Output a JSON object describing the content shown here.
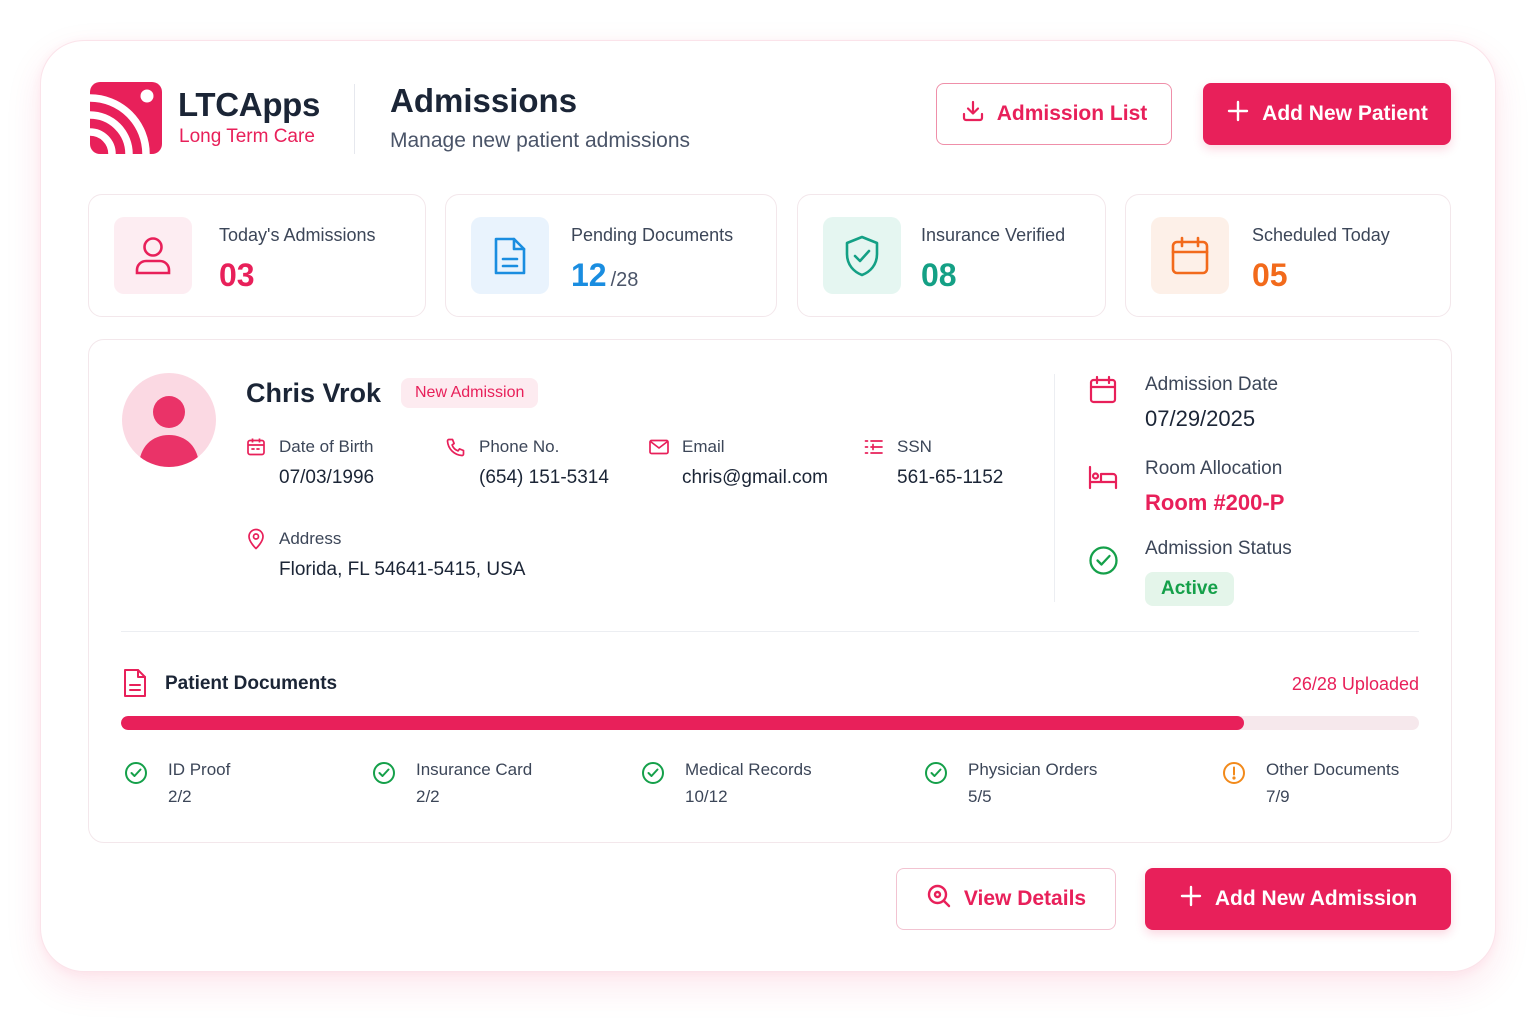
{
  "brand": {
    "name": "LTCApps",
    "subtitle": "Long Term Care"
  },
  "header": {
    "title": "Admissions",
    "subtitle": "Manage new patient admissions",
    "admission_list_label": "Admission List",
    "add_patient_label": "Add New Patient"
  },
  "stats": [
    {
      "label": "Today's Admissions",
      "value": "03",
      "color": "#e8205a",
      "icon": "user-icon"
    },
    {
      "label": "Pending Documents",
      "value": "12",
      "total": "/28",
      "color": "#1a8de0",
      "icon": "document-icon"
    },
    {
      "label": "Insurance Verified",
      "value": "08",
      "color": "#14a085",
      "icon": "shield-check-icon"
    },
    {
      "label": "Scheduled Today",
      "value": "05",
      "color": "#f26a1b",
      "icon": "calendar-icon"
    }
  ],
  "patient": {
    "name": "Chris Vrok",
    "badge": "New Admission",
    "dob_label": "Date of Birth",
    "dob": "07/03/1996",
    "phone_label": "Phone No.",
    "phone": "(654) 151-5314",
    "email_label": "Email",
    "email": "chris@gmail.com",
    "ssn_label": "SSN",
    "ssn": "561-65-1152",
    "address_label": "Address",
    "address": "Florida, FL 54641-5415, USA"
  },
  "admission": {
    "date_label": "Admission Date",
    "date": "07/29/2025",
    "room_label": "Room Allocation",
    "room": "Room #200-P",
    "status_label": "Admission Status",
    "status": "Active"
  },
  "documents": {
    "title": "Patient Documents",
    "uploaded": "26/28 Uploaded",
    "progress_fraction": 0.865,
    "items": [
      {
        "label": "ID Proof",
        "count": "2/2",
        "status": "complete"
      },
      {
        "label": "Insurance Card",
        "count": "2/2",
        "status": "complete"
      },
      {
        "label": "Medical Records",
        "count": "10/12",
        "status": "complete"
      },
      {
        "label": "Physician Orders",
        "count": "5/5",
        "status": "complete"
      },
      {
        "label": "Other Documents",
        "count": "7/9",
        "status": "warning"
      }
    ]
  },
  "footer": {
    "view_details_label": "View Details",
    "add_admission_label": "Add New Admission"
  },
  "colors": {
    "primary": "#e8205a",
    "success": "#15a04a",
    "warning": "#f28a1b"
  }
}
